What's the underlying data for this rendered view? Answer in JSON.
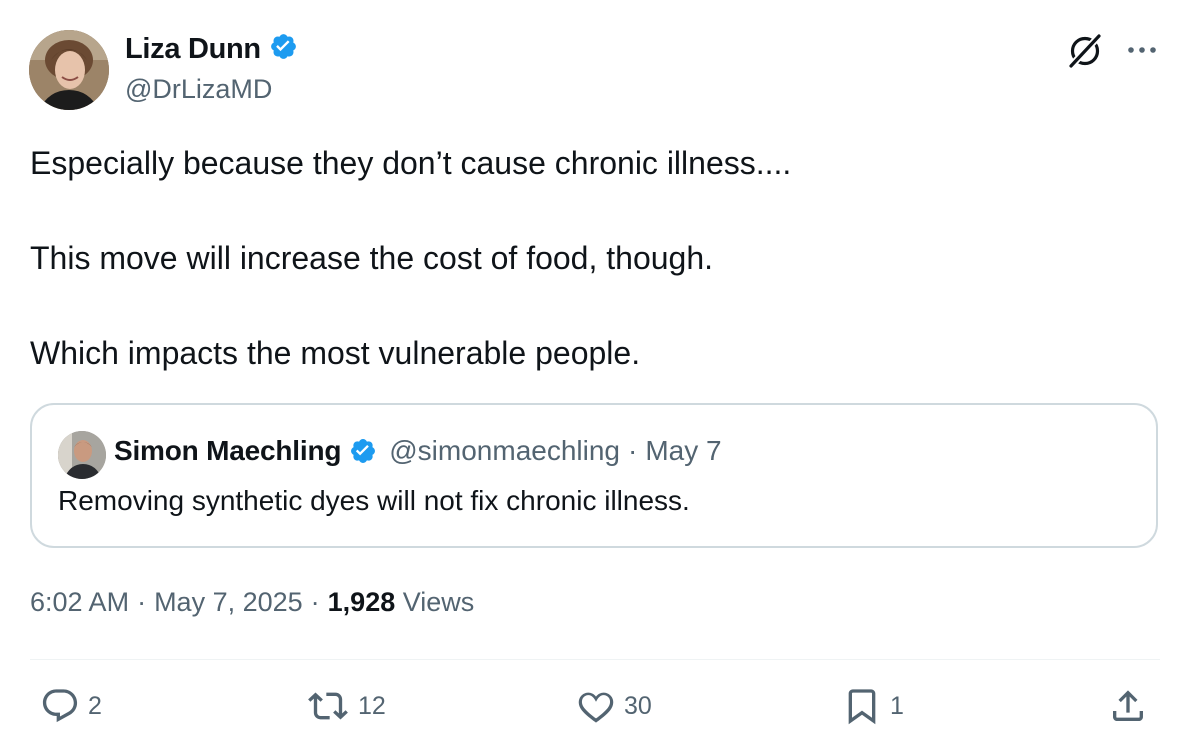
{
  "author": {
    "name": "Liza Dunn",
    "handle": "@DrLizaMD",
    "verified": true,
    "avatar": "profile-photo"
  },
  "tweet": {
    "lines": [
      "Especially because they don’t cause chronic illness....",
      "This move will increase the cost of food, though.",
      "Which impacts the most vulnerable people."
    ]
  },
  "quoted": {
    "name": "Simon Maechling",
    "handle": "@simonmaechling",
    "separator": "·",
    "date": "May 7",
    "text": "Removing synthetic dyes will not fix chronic illness."
  },
  "meta": {
    "time": "6:02 AM",
    "separator": "·",
    "date": "May 7, 2025",
    "views_count": "1,928",
    "views_label": "Views"
  },
  "actions": {
    "replies": "2",
    "reposts": "12",
    "likes": "30",
    "bookmarks": "1"
  },
  "icons": [
    "verified-badge-icon",
    "grok-icon",
    "more-icon",
    "reply-icon",
    "repost-icon",
    "like-icon",
    "bookmark-icon",
    "share-icon"
  ],
  "colors": {
    "verified": "#1d9bf0",
    "text": "#0f1419",
    "secondary": "#536471",
    "border": "#cfd9de"
  }
}
